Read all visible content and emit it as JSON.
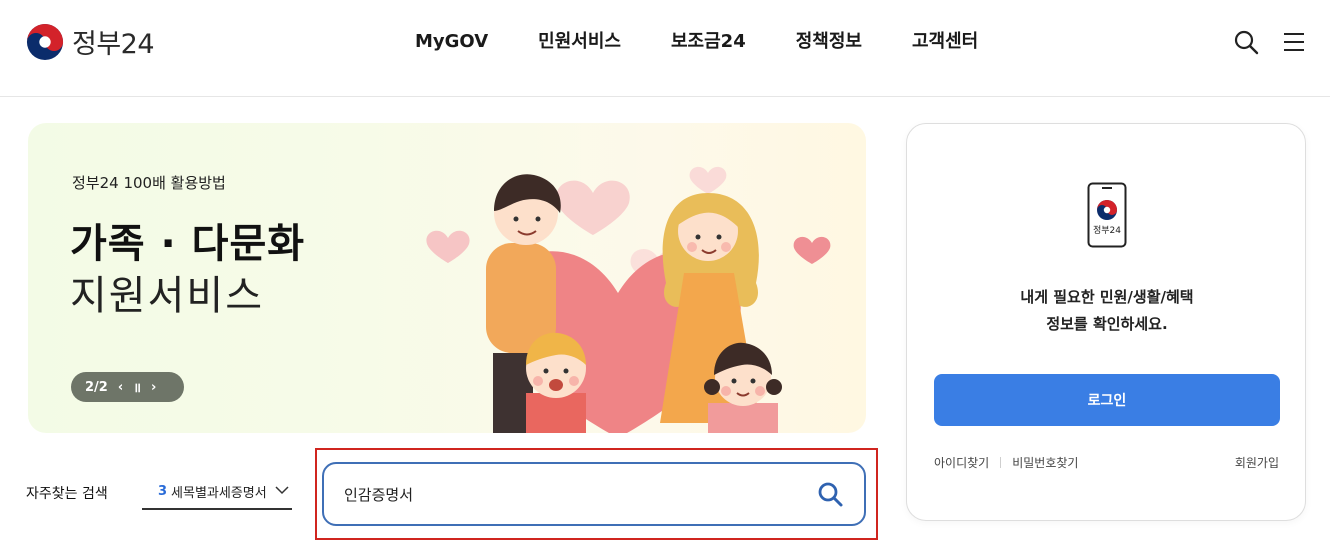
{
  "header": {
    "logo_text": "정부24",
    "nav": [
      "MyGOV",
      "민원서비스",
      "보조금24",
      "정책정보",
      "고객센터"
    ],
    "icons": [
      "search-icon",
      "menu-icon"
    ]
  },
  "banner": {
    "subtitle": "정부24 100배 활용방법",
    "title": "가족 · 다문화",
    "title2": "지원서비스",
    "pager": "2/2",
    "prev": "‹",
    "pause": "॥",
    "next": "›"
  },
  "frequent": {
    "label": "자주찾는 검색",
    "selected_num": "3",
    "selected_text": "세목별과세증명서"
  },
  "search": {
    "value": "인감증명서"
  },
  "login": {
    "phone_label": "정부24",
    "message_line1": "내게 필요한 민원/생활/혜택",
    "message_line2": "정보를 확인하세요.",
    "button": "로그인",
    "find_id": "아이디찾기",
    "find_pw": "비밀번호찾기",
    "join": "회원가입"
  },
  "colors": {
    "accent_blue": "#3a7ee4",
    "search_border": "#3f6fb6",
    "highlight_red": "#d0251f",
    "banner_control": "#6e7568"
  }
}
